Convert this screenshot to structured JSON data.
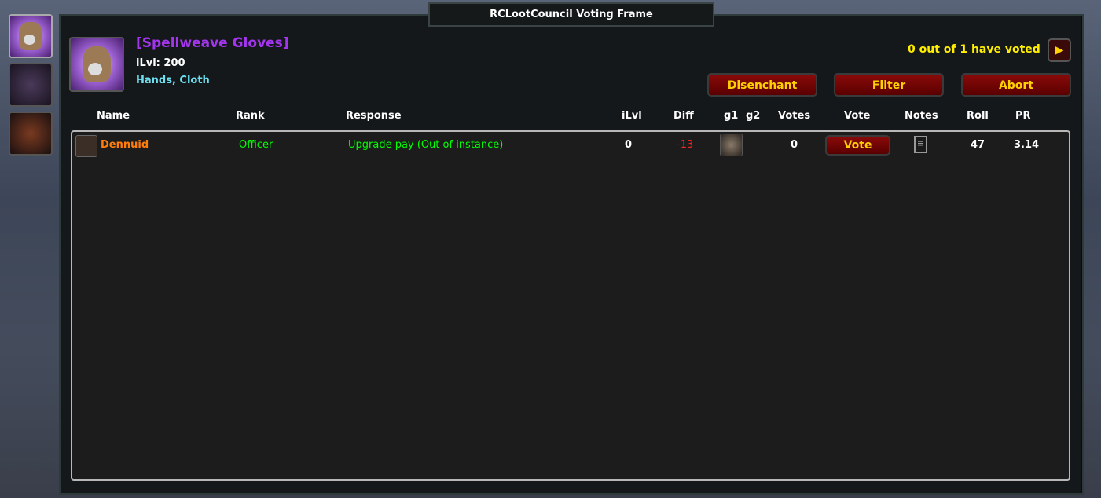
{
  "window": {
    "title": "RCLootCouncil Voting Frame"
  },
  "item": {
    "name": "[Spellweave Gloves]",
    "ilvl": "iLvl: 200",
    "type": "Hands, Cloth",
    "name_color": "#a335ee"
  },
  "vote_status": "0 out of 1 have voted",
  "buttons": {
    "disenchant": "Disenchant",
    "filter": "Filter",
    "abort": "Abort"
  },
  "columns": [
    "Name",
    "Rank",
    "Response",
    "iLvl",
    "Diff",
    "g1",
    "g2",
    "Votes",
    "Vote",
    "Notes",
    "Roll",
    "PR"
  ],
  "rows": [
    {
      "name": "Dennuid",
      "rank": "Officer",
      "response": "Upgrade pay (Out of instance)",
      "ilvl": "0",
      "diff": "-13",
      "votes": "0",
      "vote_button": "Vote",
      "roll": "47",
      "pr": "3.14",
      "name_color": "#ff7d0a",
      "response_color": "#00ff00",
      "diff_color": "#ff2020"
    }
  ]
}
